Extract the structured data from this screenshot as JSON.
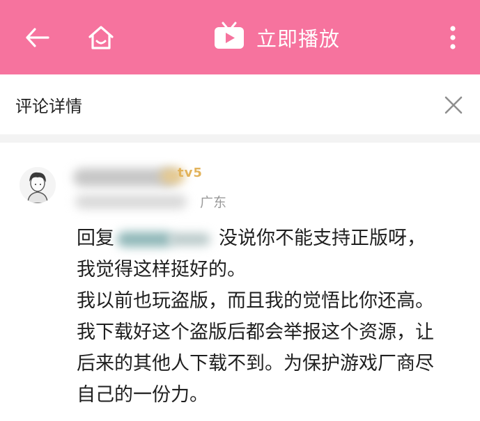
{
  "topbar": {
    "play_title": "立即播放",
    "icons": [
      "back-arrow-icon",
      "home-icon",
      "tv-play-icon",
      "more-vertical-icon"
    ]
  },
  "header": {
    "title": "评论详情",
    "close_icon": "close-icon"
  },
  "comment": {
    "user_badge": "tv5",
    "location": "广东",
    "reply_label": "回复",
    "lines": [
      "没说你不能支持正版呀，",
      "我觉得这样挺好的。",
      "我以前也玩盗版，而且我的觉悟比你还高。",
      "我下载好这个盗版后都会举报这个资源，让",
      "后来的其他人下载不到。为保护游戏厂商尽",
      "自己的一份力。"
    ]
  },
  "colors": {
    "brand_pink": "#f6739e",
    "badge_gold": "#e2b35c",
    "meta_gray": "#9a9a9a"
  }
}
